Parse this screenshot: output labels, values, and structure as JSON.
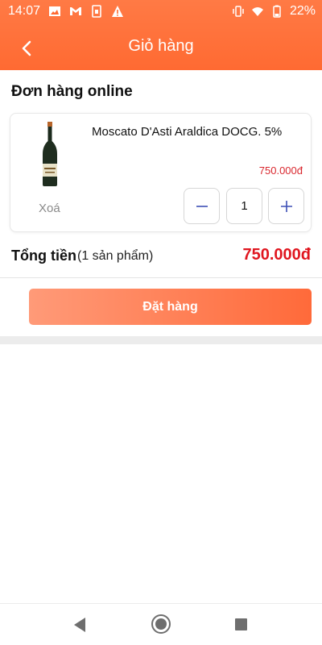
{
  "status_bar": {
    "time": "14:07",
    "battery": "22%",
    "icons": [
      "image-icon",
      "gmail-icon",
      "sim-icon",
      "alert-icon",
      "vibrate-icon",
      "wifi-icon",
      "battery-icon"
    ]
  },
  "header": {
    "title": "Giỏ hàng",
    "background": "#ff6a32"
  },
  "section": {
    "title": "Đơn hàng online"
  },
  "cart_item": {
    "name": "Moscato D'Asti Araldica DOCG. 5%",
    "price": "750.000đ",
    "delete_label": "Xoá",
    "quantity": "1"
  },
  "total": {
    "label": "Tổng tiền",
    "count": "(1 sản phẩm)",
    "amount": "750.000đ"
  },
  "order_button": {
    "label": "Đặt hàng"
  },
  "colors": {
    "accent": "#ff6a32",
    "price_red": "#e0161f",
    "qty_icon_blue": "#3d4fb5"
  }
}
